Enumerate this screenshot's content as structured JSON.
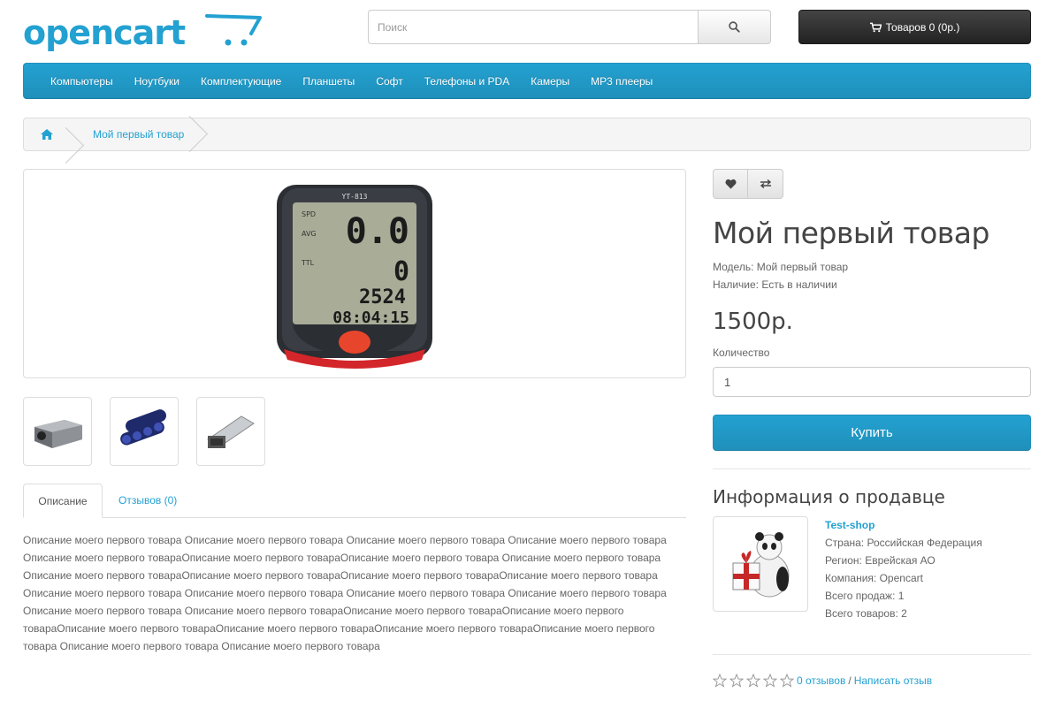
{
  "header": {
    "logo_text": "opencart",
    "search": {
      "placeholder": "Поиск"
    },
    "cart_label": "Товаров 0 (0р.)"
  },
  "menu": {
    "items": [
      "Компьютеры",
      "Ноутбуки",
      "Комплектующие",
      "Планшеты",
      "Софт",
      "Телефоны и PDA",
      "Камеры",
      "MP3 плееры"
    ]
  },
  "breadcrumb": {
    "items": [
      "Мой первый товар"
    ]
  },
  "product": {
    "title": "Мой первый товар",
    "model": "Модель: Мой первый товар",
    "availability": "Наличие: Есть в наличии",
    "price": "1500р.",
    "quantity_label": "Количество",
    "quantity_value": "1",
    "buy_label": "Купить",
    "main_image_display": {
      "brand": "YT-813",
      "readout_top": "0.0",
      "readout_mid": "0",
      "readout_odo": "2524",
      "readout_time": "08:04:15",
      "labels": [
        "SPD",
        "AVG",
        "TTL"
      ]
    }
  },
  "tabs": {
    "items": [
      "Описание",
      "Отзывов (0)"
    ],
    "description": "Описание моего первого товара Описание моего первого товара Описание моего первого товара Описание моего первого товара Описание моего первого товараОписание моего первого товараОписание моего первого товара Описание моего первого товара Описание моего первого товараОписание моего первого товараОписание моего первого товараОписание моего первого товара Описание моего первого товара Описание моего первого товара Описание моего первого товара Описание моего первого товара Описание моего первого товара Описание моего первого товараОписание моего первого товараОписание моего первого товараОписание моего первого товараОписание моего первого товараОписание моего первого товараОписание моего первого товара Описание моего первого товара Описание моего первого товара"
  },
  "seller": {
    "heading": "Информация о продавце",
    "shop": "Test-shop",
    "country": "Страна: Российская Федерация",
    "region": "Регион: Еврейская АО",
    "company": "Компания: Opencart",
    "total_sales": "Всего продаж: 1",
    "total_products": "Всего товаров: 2"
  },
  "rating": {
    "stars": 0,
    "max_stars": 5,
    "reviews_link": "0 отзывов",
    "separator": "/",
    "write_link": "Написать отзыв"
  },
  "colors": {
    "accent": "#23a1d1",
    "menu_bg": "#229ac8",
    "cart_bg": "#303030"
  }
}
